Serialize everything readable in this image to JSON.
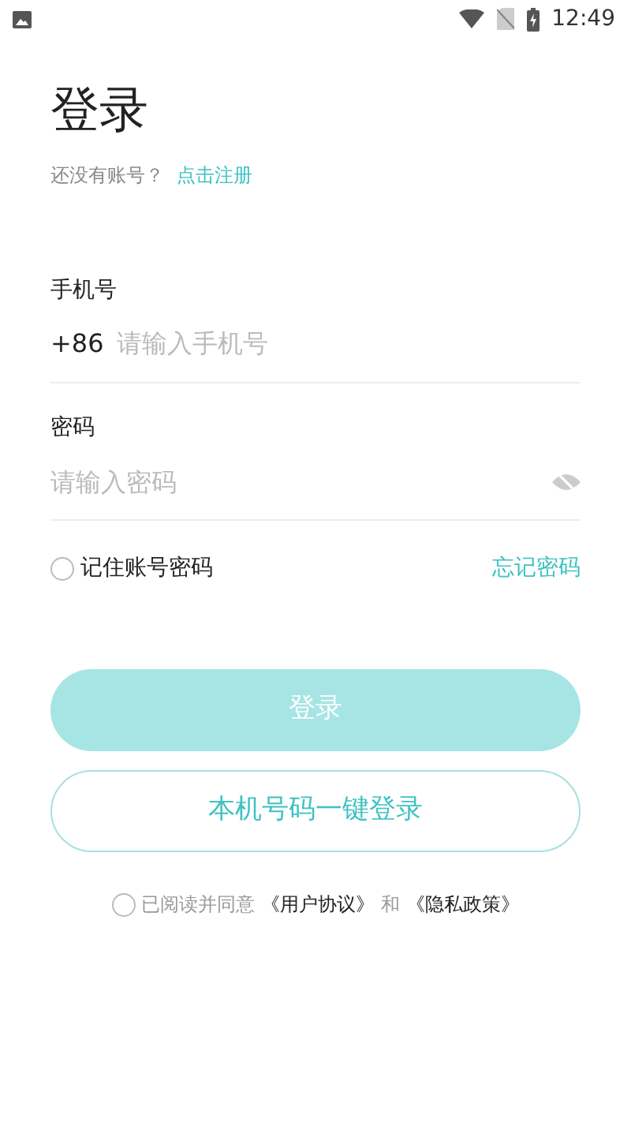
{
  "status_bar": {
    "time": "12:49"
  },
  "title": "登录",
  "signup_prompt": {
    "text": "还没有账号？",
    "link": "点击注册"
  },
  "phone": {
    "label": "手机号",
    "prefix": "+86",
    "placeholder": "请输入手机号"
  },
  "password": {
    "label": "密码",
    "placeholder": "请输入密码",
    "visible": false
  },
  "remember": {
    "label": "记住账号密码",
    "checked": false
  },
  "forgot_link": "忘记密码",
  "login_button": {
    "label": "登录",
    "disabled": true
  },
  "one_click_button": {
    "label": "本机号码一键登录"
  },
  "agreement": {
    "checked": false,
    "prefix": "已阅读并同意",
    "link_1": "《用户协议》",
    "joiner": "和",
    "link_2": "《隐私政策》"
  }
}
